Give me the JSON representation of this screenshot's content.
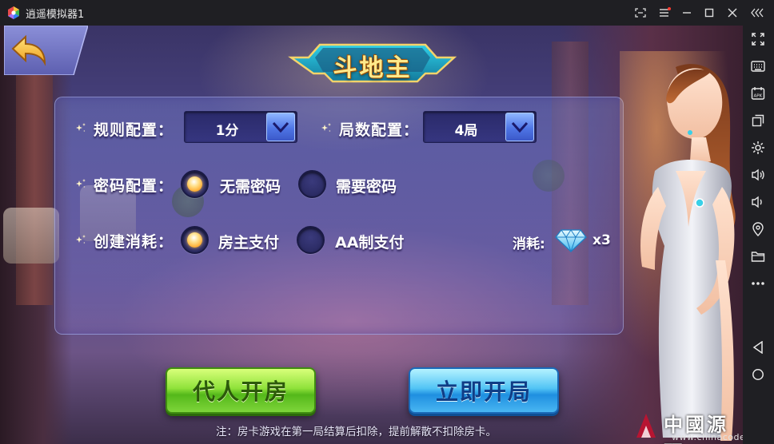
{
  "window": {
    "title": "逍遥模拟器1",
    "buttons": [
      "screenshot-toggle",
      "menu",
      "minimize",
      "maximize",
      "close",
      "collapse-sidebar"
    ]
  },
  "sidebar": {
    "items": [
      "fullscreen-icon",
      "keyboard-icon",
      "apk-icon",
      "multi-window-icon",
      "settings-icon",
      "volume-up-icon",
      "volume-down-icon",
      "location-icon",
      "folder-icon",
      "more-icon",
      "back-nav-icon",
      "home-nav-icon"
    ]
  },
  "game": {
    "title": "斗地主",
    "rules": {
      "label": "规则配置：",
      "value": "1分"
    },
    "rounds": {
      "label": "局数配置：",
      "value": "4局"
    },
    "password": {
      "label": "密码配置：",
      "options": [
        {
          "label": "无需密码",
          "selected": true
        },
        {
          "label": "需要密码",
          "selected": false
        }
      ]
    },
    "cost_config": {
      "label": "创建消耗：",
      "options": [
        {
          "label": "房主支付",
          "selected": true
        },
        {
          "label": "AA制支付",
          "selected": false
        }
      ]
    },
    "cost": {
      "label": "消耗:",
      "amount": "x3",
      "icon": "diamond-icon"
    },
    "buttons": {
      "proxy": "代人开房",
      "start": "立即开局"
    },
    "note": "注：房卡游戏在第一局结算后扣除，提前解散不扣除房卡。"
  },
  "watermark": {
    "text": "中國源碼",
    "url": "www.chinacode.com"
  },
  "colors": {
    "accent_green": "#8fe23a",
    "accent_blue": "#52c4f5",
    "title_gold": "#ffe98a",
    "panel_bg": "#4c4686"
  }
}
